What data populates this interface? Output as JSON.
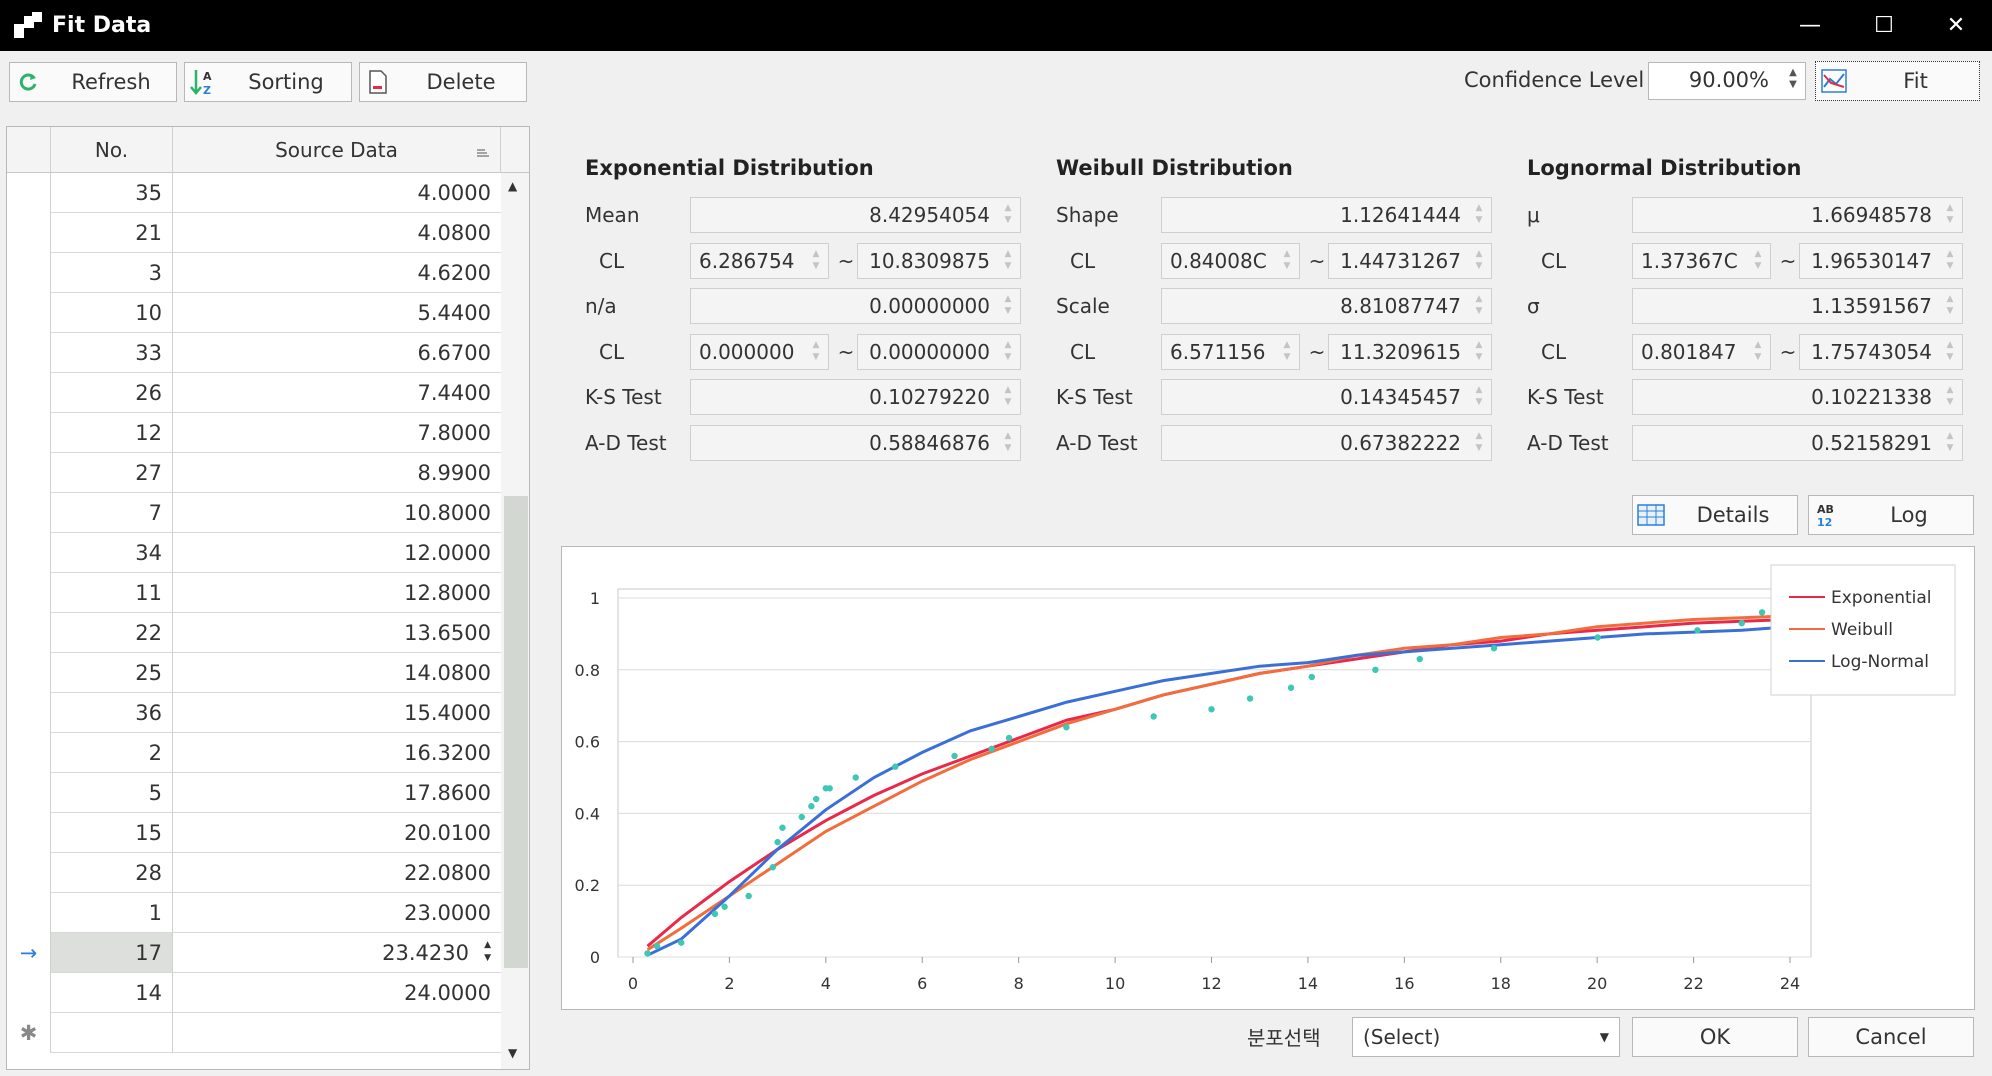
{
  "window": {
    "title": "Fit Data",
    "minimize_glyph": "—",
    "maximize_glyph": "☐",
    "close_glyph": "✕"
  },
  "toolbar": {
    "refresh_label": "Refresh",
    "sorting_label": "Sorting",
    "delete_label": "Delete",
    "confidence_label": "Confidence Level",
    "confidence_value": "90.00%",
    "fit_label": "Fit"
  },
  "grid": {
    "headers": {
      "no": "No.",
      "source": "Source Data"
    },
    "rows": [
      {
        "no": "35",
        "value": "4.0000"
      },
      {
        "no": "21",
        "value": "4.0800"
      },
      {
        "no": "3",
        "value": "4.6200"
      },
      {
        "no": "10",
        "value": "5.4400"
      },
      {
        "no": "33",
        "value": "6.6700"
      },
      {
        "no": "26",
        "value": "7.4400"
      },
      {
        "no": "12",
        "value": "7.8000"
      },
      {
        "no": "27",
        "value": "8.9900"
      },
      {
        "no": "7",
        "value": "10.8000"
      },
      {
        "no": "34",
        "value": "12.0000"
      },
      {
        "no": "11",
        "value": "12.8000"
      },
      {
        "no": "22",
        "value": "13.6500"
      },
      {
        "no": "25",
        "value": "14.0800"
      },
      {
        "no": "36",
        "value": "15.4000"
      },
      {
        "no": "2",
        "value": "16.3200"
      },
      {
        "no": "5",
        "value": "17.8600"
      },
      {
        "no": "15",
        "value": "20.0100"
      },
      {
        "no": "28",
        "value": "22.0800"
      },
      {
        "no": "1",
        "value": "23.0000"
      },
      {
        "no": "17",
        "value": "23.4230"
      },
      {
        "no": "14",
        "value": "24.0000"
      }
    ],
    "current_row_marker": "→",
    "new_row_marker": "✱"
  },
  "distributions": [
    {
      "title": "Exponential Distribution",
      "p1_label": "Mean",
      "p1_value": "8.42954054",
      "cl1_label": "CL",
      "cl1_low": "6.286754",
      "cl1_high": "10.8309875",
      "p2_label": "n/a",
      "p2_value": "0.00000000",
      "cl2_label": "CL",
      "cl2_low": "0.000000",
      "cl2_high": "0.00000000",
      "ks_label": "K-S Test",
      "ks_value": "0.10279220",
      "ad_label": "A-D Test",
      "ad_value": "0.58846876"
    },
    {
      "title": "Weibull Distribution",
      "p1_label": "Shape",
      "p1_value": "1.12641444",
      "cl1_label": "CL",
      "cl1_low": "0.84008C",
      "cl1_high": "1.44731267",
      "p2_label": "Scale",
      "p2_value": "8.81087747",
      "cl2_label": "CL",
      "cl2_low": "6.571156",
      "cl2_high": "11.3209615",
      "ks_label": "K-S Test",
      "ks_value": "0.14345457",
      "ad_label": "A-D Test",
      "ad_value": "0.67382222"
    },
    {
      "title": "Lognormal Distribution",
      "p1_label": "μ",
      "p1_value": "1.66948578",
      "cl1_label": "CL",
      "cl1_low": "1.37367C",
      "cl1_high": "1.96530147",
      "p2_label": "σ",
      "p2_value": "1.13591567",
      "cl2_label": "CL",
      "cl2_low": "0.801847",
      "cl2_high": "1.75743054",
      "ks_label": "K-S Test",
      "ks_value": "0.10221338",
      "ad_label": "A-D Test",
      "ad_value": "0.52158291"
    }
  ],
  "tilde": "~",
  "chart_buttons": {
    "details_label": "Details",
    "log_label": "Log",
    "log_icon_text": "AB\n12"
  },
  "footer": {
    "dist_select_label": "분포선택",
    "dist_select_value": "(Select)",
    "ok_label": "OK",
    "cancel_label": "Cancel"
  },
  "colors": {
    "exponential": "#e8294a",
    "weibull": "#f26d3d",
    "lognormal": "#3a6fd8",
    "data_points": "#3ec7b4"
  },
  "chart_data": {
    "type": "line",
    "xlim": [
      0,
      24
    ],
    "ylim": [
      0,
      1
    ],
    "xticks": [
      "0",
      "2",
      "4",
      "6",
      "8",
      "10",
      "12",
      "14",
      "16",
      "18",
      "20",
      "22",
      "24"
    ],
    "yticks": [
      "0",
      "0.2",
      "0.4",
      "0.6",
      "0.8",
      "1"
    ],
    "legend_position": "top-right",
    "grid": true,
    "series": [
      {
        "name": "Exponential",
        "x": [
          0.3,
          1,
          2,
          3,
          4,
          5,
          6,
          7,
          8,
          9,
          10,
          11,
          12,
          13,
          14,
          15,
          16,
          17,
          18,
          19,
          20,
          21,
          22,
          23,
          24
        ],
        "y": [
          0.03,
          0.11,
          0.21,
          0.3,
          0.38,
          0.45,
          0.51,
          0.56,
          0.61,
          0.66,
          0.69,
          0.73,
          0.76,
          0.79,
          0.81,
          0.83,
          0.85,
          0.87,
          0.88,
          0.9,
          0.91,
          0.92,
          0.93,
          0.935,
          0.94
        ]
      },
      {
        "name": "Weibull",
        "x": [
          0.3,
          1,
          2,
          3,
          4,
          5,
          6,
          7,
          8,
          9,
          10,
          11,
          12,
          13,
          14,
          15,
          16,
          17,
          18,
          19,
          20,
          21,
          22,
          23,
          24
        ],
        "y": [
          0.02,
          0.08,
          0.17,
          0.26,
          0.35,
          0.42,
          0.49,
          0.55,
          0.6,
          0.65,
          0.69,
          0.73,
          0.76,
          0.79,
          0.81,
          0.84,
          0.86,
          0.87,
          0.89,
          0.9,
          0.92,
          0.93,
          0.94,
          0.945,
          0.95
        ]
      },
      {
        "name": "Log-Normal",
        "x": [
          0.3,
          1,
          2,
          3,
          4,
          5,
          6,
          7,
          8,
          9,
          10,
          11,
          12,
          13,
          14,
          15,
          16,
          17,
          18,
          19,
          20,
          21,
          22,
          23,
          24
        ],
        "y": [
          0.005,
          0.05,
          0.17,
          0.3,
          0.41,
          0.5,
          0.57,
          0.63,
          0.67,
          0.71,
          0.74,
          0.77,
          0.79,
          0.81,
          0.82,
          0.84,
          0.85,
          0.86,
          0.87,
          0.88,
          0.89,
          0.9,
          0.905,
          0.91,
          0.92
        ]
      }
    ],
    "points": {
      "x": [
        0.3,
        0.5,
        1.0,
        1.7,
        1.9,
        2.4,
        2.9,
        3.0,
        3.1,
        3.5,
        3.7,
        3.8,
        4.0,
        4.08,
        4.62,
        5.44,
        6.67,
        7.44,
        7.8,
        8.99,
        10.8,
        12.0,
        12.8,
        13.65,
        14.08,
        15.4,
        16.32,
        17.86,
        20.01,
        22.08,
        23.0,
        23.42,
        24.0
      ],
      "y": [
        0.01,
        0.03,
        0.04,
        0.12,
        0.14,
        0.17,
        0.25,
        0.32,
        0.36,
        0.39,
        0.42,
        0.44,
        0.47,
        0.47,
        0.5,
        0.53,
        0.56,
        0.58,
        0.61,
        0.64,
        0.67,
        0.69,
        0.72,
        0.75,
        0.78,
        0.8,
        0.83,
        0.86,
        0.89,
        0.91,
        0.93,
        0.96,
        0.99
      ]
    }
  }
}
